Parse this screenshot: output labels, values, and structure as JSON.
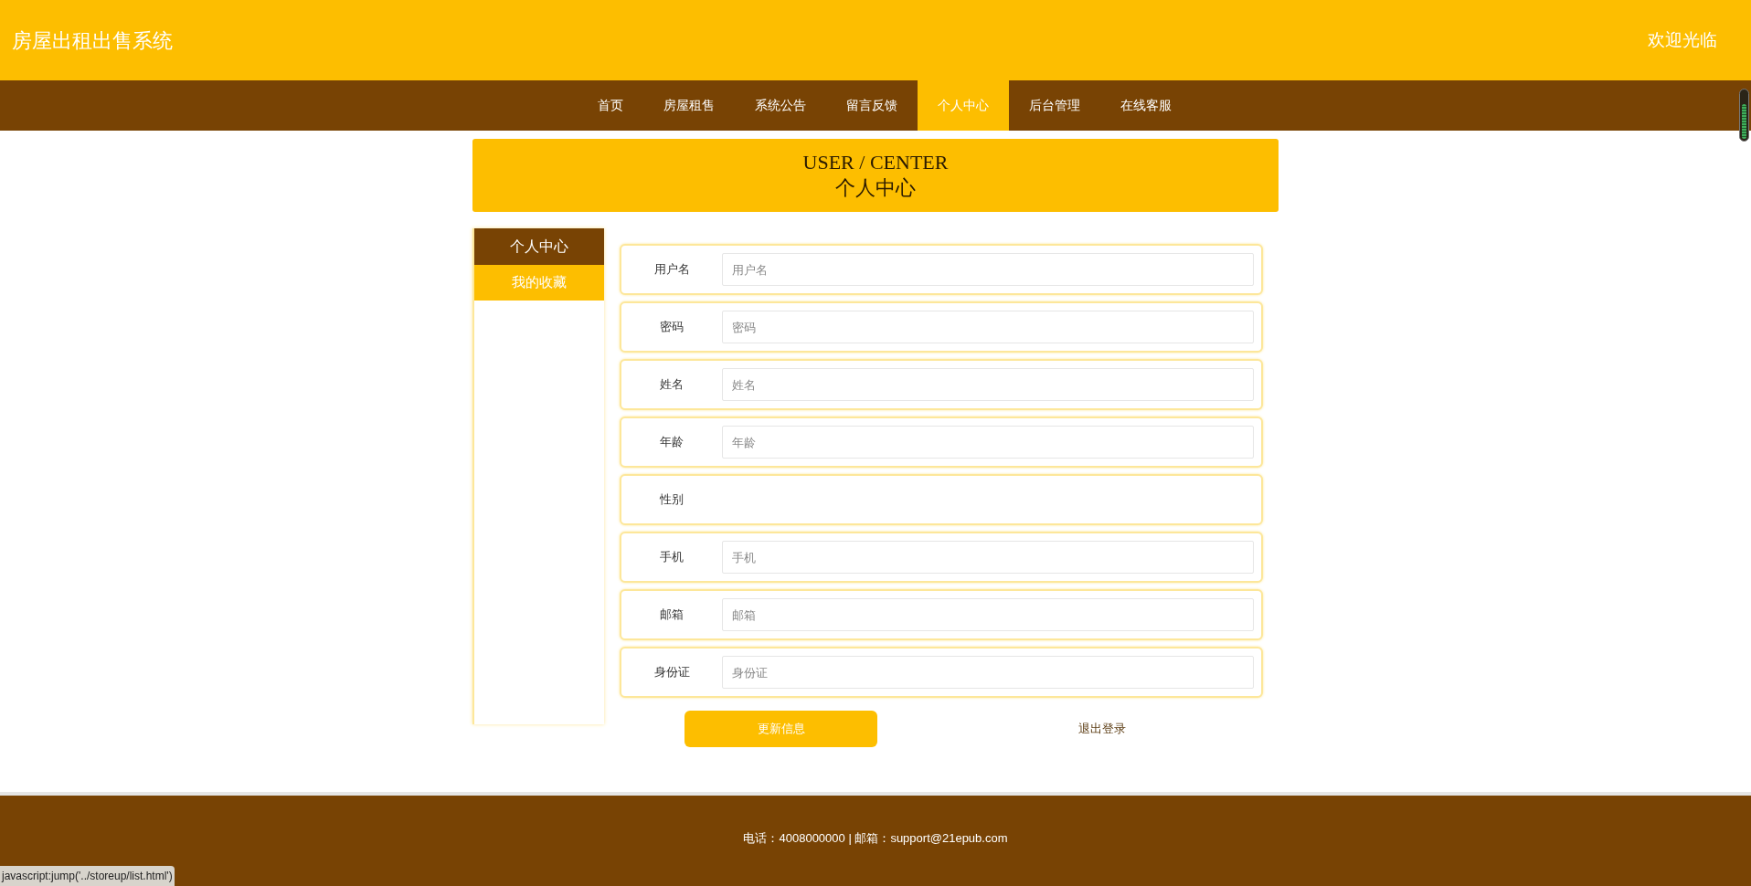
{
  "header": {
    "title": "房屋出租出售系统",
    "greeting": "欢迎光临"
  },
  "nav": [
    {
      "label": "首页",
      "selected": false
    },
    {
      "label": "房屋租售",
      "selected": false
    },
    {
      "label": "系统公告",
      "selected": false
    },
    {
      "label": "留言反馈",
      "selected": false
    },
    {
      "label": "个人中心",
      "selected": true
    },
    {
      "label": "后台管理",
      "selected": false
    },
    {
      "label": "在线客服",
      "selected": false
    }
  ],
  "banner": {
    "title_en": "USER / CENTER",
    "title": "个人中心"
  },
  "sidebar": {
    "title": "个人中心",
    "items": [
      {
        "label": "我的收藏",
        "highlighted": true
      }
    ]
  },
  "form": {
    "fields": [
      {
        "kind": "input",
        "label": "用户名",
        "placeholder": "用户名"
      },
      {
        "kind": "input",
        "label": "密码",
        "placeholder": "密码"
      },
      {
        "kind": "input",
        "label": "姓名",
        "placeholder": "姓名"
      },
      {
        "kind": "input",
        "label": "年龄",
        "placeholder": "年龄"
      },
      {
        "kind": "empty",
        "label": "性别"
      },
      {
        "kind": "input",
        "label": "手机",
        "placeholder": "手机"
      },
      {
        "kind": "input",
        "label": "邮箱",
        "placeholder": "邮箱"
      },
      {
        "kind": "input",
        "label": "身份证",
        "placeholder": "身份证"
      }
    ],
    "buttons": [
      {
        "kind": "primary",
        "label": "更新信息"
      },
      {
        "kind": "link",
        "label": "退出登录"
      }
    ]
  },
  "footer": {
    "text": "电话：4008000000 | 邮箱：support@21epub.com"
  },
  "status_bar": {
    "text": "javascript:jump('../storeup/list.html')"
  }
}
